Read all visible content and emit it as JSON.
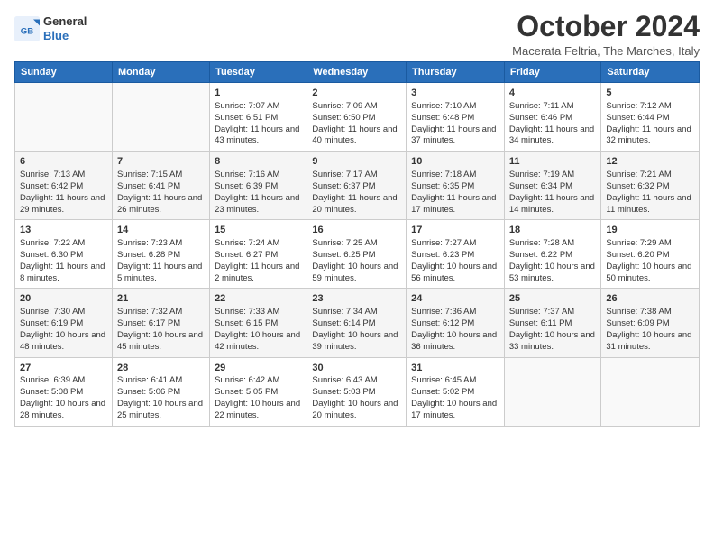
{
  "header": {
    "logo_general": "General",
    "logo_blue": "Blue",
    "month_title": "October 2024",
    "location": "Macerata Feltria, The Marches, Italy"
  },
  "days_of_week": [
    "Sunday",
    "Monday",
    "Tuesday",
    "Wednesday",
    "Thursday",
    "Friday",
    "Saturday"
  ],
  "weeks": [
    [
      {
        "day": "",
        "sunrise": "",
        "sunset": "",
        "daylight": ""
      },
      {
        "day": "",
        "sunrise": "",
        "sunset": "",
        "daylight": ""
      },
      {
        "day": "1",
        "sunrise": "Sunrise: 7:07 AM",
        "sunset": "Sunset: 6:51 PM",
        "daylight": "Daylight: 11 hours and 43 minutes."
      },
      {
        "day": "2",
        "sunrise": "Sunrise: 7:09 AM",
        "sunset": "Sunset: 6:50 PM",
        "daylight": "Daylight: 11 hours and 40 minutes."
      },
      {
        "day": "3",
        "sunrise": "Sunrise: 7:10 AM",
        "sunset": "Sunset: 6:48 PM",
        "daylight": "Daylight: 11 hours and 37 minutes."
      },
      {
        "day": "4",
        "sunrise": "Sunrise: 7:11 AM",
        "sunset": "Sunset: 6:46 PM",
        "daylight": "Daylight: 11 hours and 34 minutes."
      },
      {
        "day": "5",
        "sunrise": "Sunrise: 7:12 AM",
        "sunset": "Sunset: 6:44 PM",
        "daylight": "Daylight: 11 hours and 32 minutes."
      }
    ],
    [
      {
        "day": "6",
        "sunrise": "Sunrise: 7:13 AM",
        "sunset": "Sunset: 6:42 PM",
        "daylight": "Daylight: 11 hours and 29 minutes."
      },
      {
        "day": "7",
        "sunrise": "Sunrise: 7:15 AM",
        "sunset": "Sunset: 6:41 PM",
        "daylight": "Daylight: 11 hours and 26 minutes."
      },
      {
        "day": "8",
        "sunrise": "Sunrise: 7:16 AM",
        "sunset": "Sunset: 6:39 PM",
        "daylight": "Daylight: 11 hours and 23 minutes."
      },
      {
        "day": "9",
        "sunrise": "Sunrise: 7:17 AM",
        "sunset": "Sunset: 6:37 PM",
        "daylight": "Daylight: 11 hours and 20 minutes."
      },
      {
        "day": "10",
        "sunrise": "Sunrise: 7:18 AM",
        "sunset": "Sunset: 6:35 PM",
        "daylight": "Daylight: 11 hours and 17 minutes."
      },
      {
        "day": "11",
        "sunrise": "Sunrise: 7:19 AM",
        "sunset": "Sunset: 6:34 PM",
        "daylight": "Daylight: 11 hours and 14 minutes."
      },
      {
        "day": "12",
        "sunrise": "Sunrise: 7:21 AM",
        "sunset": "Sunset: 6:32 PM",
        "daylight": "Daylight: 11 hours and 11 minutes."
      }
    ],
    [
      {
        "day": "13",
        "sunrise": "Sunrise: 7:22 AM",
        "sunset": "Sunset: 6:30 PM",
        "daylight": "Daylight: 11 hours and 8 minutes."
      },
      {
        "day": "14",
        "sunrise": "Sunrise: 7:23 AM",
        "sunset": "Sunset: 6:28 PM",
        "daylight": "Daylight: 11 hours and 5 minutes."
      },
      {
        "day": "15",
        "sunrise": "Sunrise: 7:24 AM",
        "sunset": "Sunset: 6:27 PM",
        "daylight": "Daylight: 11 hours and 2 minutes."
      },
      {
        "day": "16",
        "sunrise": "Sunrise: 7:25 AM",
        "sunset": "Sunset: 6:25 PM",
        "daylight": "Daylight: 10 hours and 59 minutes."
      },
      {
        "day": "17",
        "sunrise": "Sunrise: 7:27 AM",
        "sunset": "Sunset: 6:23 PM",
        "daylight": "Daylight: 10 hours and 56 minutes."
      },
      {
        "day": "18",
        "sunrise": "Sunrise: 7:28 AM",
        "sunset": "Sunset: 6:22 PM",
        "daylight": "Daylight: 10 hours and 53 minutes."
      },
      {
        "day": "19",
        "sunrise": "Sunrise: 7:29 AM",
        "sunset": "Sunset: 6:20 PM",
        "daylight": "Daylight: 10 hours and 50 minutes."
      }
    ],
    [
      {
        "day": "20",
        "sunrise": "Sunrise: 7:30 AM",
        "sunset": "Sunset: 6:19 PM",
        "daylight": "Daylight: 10 hours and 48 minutes."
      },
      {
        "day": "21",
        "sunrise": "Sunrise: 7:32 AM",
        "sunset": "Sunset: 6:17 PM",
        "daylight": "Daylight: 10 hours and 45 minutes."
      },
      {
        "day": "22",
        "sunrise": "Sunrise: 7:33 AM",
        "sunset": "Sunset: 6:15 PM",
        "daylight": "Daylight: 10 hours and 42 minutes."
      },
      {
        "day": "23",
        "sunrise": "Sunrise: 7:34 AM",
        "sunset": "Sunset: 6:14 PM",
        "daylight": "Daylight: 10 hours and 39 minutes."
      },
      {
        "day": "24",
        "sunrise": "Sunrise: 7:36 AM",
        "sunset": "Sunset: 6:12 PM",
        "daylight": "Daylight: 10 hours and 36 minutes."
      },
      {
        "day": "25",
        "sunrise": "Sunrise: 7:37 AM",
        "sunset": "Sunset: 6:11 PM",
        "daylight": "Daylight: 10 hours and 33 minutes."
      },
      {
        "day": "26",
        "sunrise": "Sunrise: 7:38 AM",
        "sunset": "Sunset: 6:09 PM",
        "daylight": "Daylight: 10 hours and 31 minutes."
      }
    ],
    [
      {
        "day": "27",
        "sunrise": "Sunrise: 6:39 AM",
        "sunset": "Sunset: 5:08 PM",
        "daylight": "Daylight: 10 hours and 28 minutes."
      },
      {
        "day": "28",
        "sunrise": "Sunrise: 6:41 AM",
        "sunset": "Sunset: 5:06 PM",
        "daylight": "Daylight: 10 hours and 25 minutes."
      },
      {
        "day": "29",
        "sunrise": "Sunrise: 6:42 AM",
        "sunset": "Sunset: 5:05 PM",
        "daylight": "Daylight: 10 hours and 22 minutes."
      },
      {
        "day": "30",
        "sunrise": "Sunrise: 6:43 AM",
        "sunset": "Sunset: 5:03 PM",
        "daylight": "Daylight: 10 hours and 20 minutes."
      },
      {
        "day": "31",
        "sunrise": "Sunrise: 6:45 AM",
        "sunset": "Sunset: 5:02 PM",
        "daylight": "Daylight: 10 hours and 17 minutes."
      },
      {
        "day": "",
        "sunrise": "",
        "sunset": "",
        "daylight": ""
      },
      {
        "day": "",
        "sunrise": "",
        "sunset": "",
        "daylight": ""
      }
    ]
  ]
}
